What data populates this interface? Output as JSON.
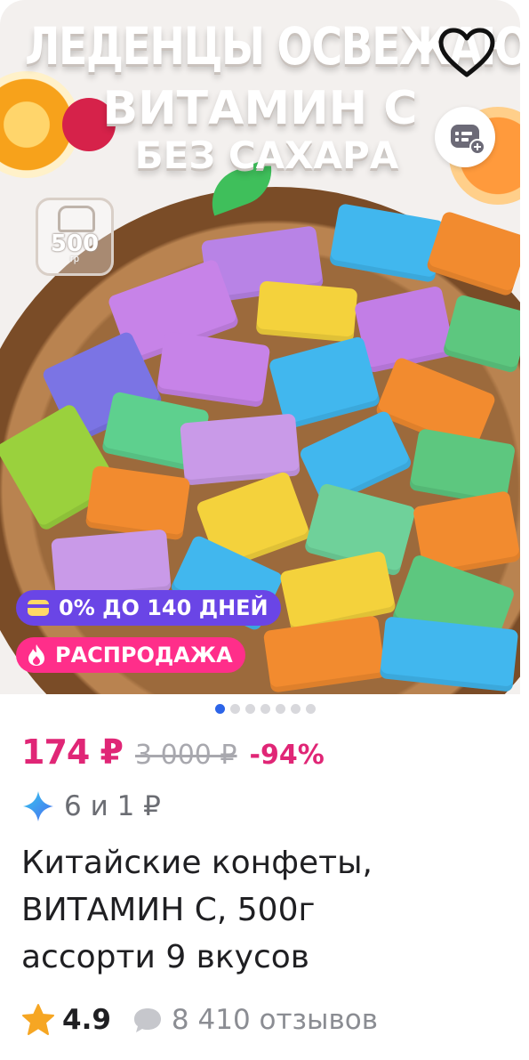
{
  "product_image": {
    "headline_line1": "ЛЕДЕНЦЫ ОСВЕЖАЮЩИЕ",
    "headline_line2": "ВИТАМИН С",
    "headline_line3": "БЕЗ САХАРА",
    "weight_value": "500",
    "weight_unit": "гр"
  },
  "badges": {
    "installment": "0% ДО 140 ДНЕЙ",
    "sale": "РАСПРОДАЖА"
  },
  "carousel": {
    "total": 7,
    "active_index": 0
  },
  "price": {
    "current": "174 ₽",
    "old": "3 000 ₽",
    "discount": "-94%"
  },
  "bonus": {
    "text": "6 и 1 ₽"
  },
  "product_title": {
    "line1": "Китайские конфеты,",
    "line2": "ВИТАМИН С, 500г",
    "line3": "ассорти 9 вкусов"
  },
  "rating": {
    "value": "4.9",
    "reviews": "8 410 отзывов"
  },
  "colors": {
    "price": "#e02676",
    "installment_badge": "#6a45e6",
    "sale_badge": "#ff2e8a",
    "active_dot": "#2c64e8",
    "rating_star": "#f6a623"
  },
  "icons": {
    "favorite": "heart-icon",
    "compare": "compare-list-icon",
    "installment": "card-icon",
    "sale": "flame-icon",
    "bonus": "sparkle-icon",
    "rating": "star-icon",
    "reviews": "speech-bubble-icon"
  }
}
